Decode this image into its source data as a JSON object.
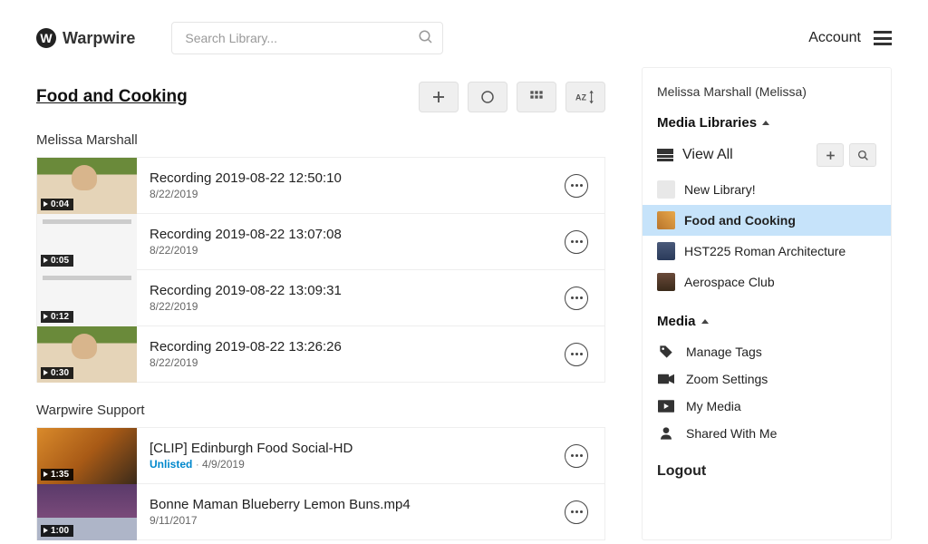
{
  "header": {
    "brand": "Warpwire",
    "search_placeholder": "Search Library...",
    "account_label": "Account"
  },
  "page": {
    "title": "Food and Cooking"
  },
  "groups": [
    {
      "owner": "Melissa Marshall",
      "items": [
        {
          "title": "Recording 2019-08-22 12:50:10",
          "date": "8/22/2019",
          "duration": "0:04",
          "thumb": "person",
          "status": ""
        },
        {
          "title": "Recording 2019-08-22 13:07:08",
          "date": "8/22/2019",
          "duration": "0:05",
          "thumb": "browser",
          "status": ""
        },
        {
          "title": "Recording 2019-08-22 13:09:31",
          "date": "8/22/2019",
          "duration": "0:12",
          "thumb": "browser",
          "status": ""
        },
        {
          "title": "Recording 2019-08-22 13:26:26",
          "date": "8/22/2019",
          "duration": "0:30",
          "thumb": "person",
          "status": ""
        }
      ]
    },
    {
      "owner": "Warpwire Support",
      "items": [
        {
          "title": "[CLIP] Edinburgh Food Social-HD",
          "date": "4/9/2019",
          "duration": "1:35",
          "thumb": "food1",
          "status": "Unlisted"
        },
        {
          "title": "Bonne Maman Blueberry Lemon Buns.mp4",
          "date": "9/11/2017",
          "duration": "1:00",
          "thumb": "food2",
          "status": ""
        }
      ]
    }
  ],
  "sidebar": {
    "user_display": "Melissa Marshall (Melissa)",
    "libraries_header": "Media Libraries",
    "view_all_label": "View All",
    "libraries": [
      {
        "label": "New Library!",
        "thumb": "new",
        "active": false
      },
      {
        "label": "Food and Cooking",
        "thumb": "food",
        "active": true
      },
      {
        "label": "HST225 Roman Architecture",
        "thumb": "roman",
        "active": false
      },
      {
        "label": "Aerospace Club",
        "thumb": "aero",
        "active": false
      }
    ],
    "media_header": "Media",
    "media_items": [
      {
        "label": "Manage Tags",
        "icon": "tag"
      },
      {
        "label": "Zoom Settings",
        "icon": "camera"
      },
      {
        "label": "My Media",
        "icon": "play"
      },
      {
        "label": "Shared With Me",
        "icon": "person"
      }
    ],
    "logout_label": "Logout"
  }
}
